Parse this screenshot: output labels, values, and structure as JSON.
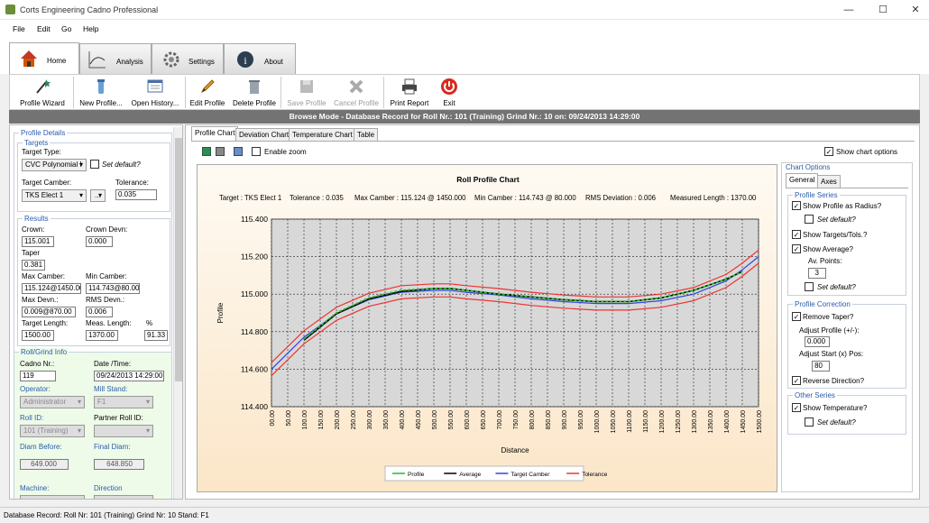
{
  "window": {
    "title": "Corts Engineering Cadno Professional"
  },
  "menu": [
    "File",
    "Edit",
    "Go",
    "Help"
  ],
  "main_tabs": [
    "Home",
    "Analysis",
    "Settings",
    "About"
  ],
  "toolbar": {
    "profile_wizard": "Profile Wizard",
    "new_profile": "New Profile...",
    "open_history": "Open History...",
    "edit_profile": "Edit Profile",
    "delete_profile": "Delete Profile",
    "save_profile": "Save Profile",
    "cancel_profile": "Cancel Profile",
    "print_report": "Print Report",
    "exit": "Exit"
  },
  "mode_banner": "Browse Mode - Database Record for Roll Nr.: 101 (Training) Grind Nr.: 10 on: 09/24/2013 14:29:00",
  "left": {
    "profile_details": "Profile Details",
    "targets": {
      "title": "Targets",
      "target_type_label": "Target Type:",
      "target_type": "CVC Polynomial I",
      "set_default": "Set default?",
      "target_camber_label": "Target Camber:",
      "target_camber": "TKS Elect 1",
      "browse": "...",
      "tolerance_label": "Tolerance:",
      "tolerance": "0.035"
    },
    "results": {
      "title": "Results",
      "crown_label": "Crown:",
      "crown": "115.001",
      "crown_devn_label": "Crown Devn:",
      "crown_devn": "0.000",
      "taper_label": "Taper",
      "taper": "0.381",
      "max_camber_label": "Max Camber:",
      "max_camber": "115.124@1450.00",
      "min_camber_label": "Min Camber:",
      "min_camber": "114.743@80.00",
      "max_devn_label": "Max Devn.:",
      "max_devn": "0.009@870.00",
      "rms_devn_label": "RMS  Devn.:",
      "rms_devn": "0.006",
      "target_length_label": "Target Length:",
      "target_length": "1500.00",
      "meas_length_label": "Meas. Length:",
      "meas_length": "1370.00",
      "pct_label": "%",
      "pct": "91.33"
    },
    "roll_grind": {
      "title": "Roll/Grind Info",
      "cadno_nr_label": "Cadno Nr.:",
      "cadno_nr": "119",
      "datetime_label": "Date /Time:",
      "datetime": "09/24/2013 14:29:00",
      "operator_label": "Operator:",
      "operator": "Administrator",
      "mill_stand_label": "Mill Stand:",
      "mill_stand": "F1",
      "roll_id_label": "Roll ID:",
      "roll_id": "101 (Training)",
      "partner_label": "Partner Roll ID:",
      "partner": "",
      "diam_before_label": "Diam Before:",
      "diam_before": "649.000",
      "final_diam_label": "Final Diam:",
      "final_diam": "648.850",
      "machine_label": "Machine:",
      "direction_label": "Direction"
    }
  },
  "chart_tabs": [
    "Profile Chart",
    "Deviation Chart",
    "Temperature Chart",
    "Table"
  ],
  "enable_zoom": "Enable zoom",
  "show_chart_options": "Show chart options",
  "chart_info": {
    "target": "Target : TKS Elect 1",
    "tolerance": "Tolerance : 0.035",
    "max_camber": "Max Camber : 115.124 @ 1450.000",
    "min_camber": "Min Camber : 114.743 @ 80.000",
    "rms": "RMS Deviation : 0.006",
    "measured": "Measured Length : 1370.00"
  },
  "chart_data": {
    "type": "line",
    "title": "Roll Profile Chart",
    "xlabel": "Distance",
    "ylabel": "Profile",
    "xlim": [
      0,
      1500
    ],
    "ylim": [
      114.4,
      115.4
    ],
    "xticks": [
      "00.00",
      "50.00",
      "100.00",
      "150.00",
      "200.00",
      "250.00",
      "300.00",
      "350.00",
      "400.00",
      "450.00",
      "500.00",
      "550.00",
      "600.00",
      "650.00",
      "700.00",
      "750.00",
      "800.00",
      "850.00",
      "900.00",
      "950.00",
      "1000.00",
      "1050.00",
      "1100.00",
      "1150.00",
      "1200.00",
      "1250.00",
      "1300.00",
      "1350.00",
      "1400.00",
      "1450.00",
      "1500.00"
    ],
    "yticks": [
      "115.400",
      "115.200",
      "115.000",
      "114.800",
      "114.600",
      "114.400"
    ],
    "grid": true,
    "legend_position": "bottom",
    "x": [
      0,
      100,
      200,
      300,
      400,
      500,
      550,
      600,
      700,
      800,
      900,
      1000,
      1100,
      1200,
      1300,
      1400,
      1450,
      1500
    ],
    "series": [
      {
        "name": "Profile",
        "color": "#22bb22",
        "dash": true,
        "values": [
          null,
          114.76,
          114.9,
          114.98,
          115.02,
          115.03,
          115.03,
          115.02,
          115.0,
          114.985,
          114.97,
          114.96,
          114.96,
          114.98,
          115.02,
          115.08,
          115.12,
          null
        ]
      },
      {
        "name": "Average",
        "color": "#000000",
        "values": [
          null,
          114.755,
          114.895,
          114.975,
          115.015,
          115.03,
          115.03,
          115.02,
          115.0,
          114.985,
          114.97,
          114.96,
          114.96,
          114.98,
          115.02,
          115.08,
          115.12,
          null
        ]
      },
      {
        "name": "Target Camber",
        "color": "#3344dd",
        "values": [
          114.6,
          114.77,
          114.895,
          114.97,
          115.01,
          115.02,
          115.02,
          115.01,
          114.995,
          114.975,
          114.96,
          114.95,
          114.95,
          114.965,
          115.0,
          115.07,
          115.13,
          115.2
        ]
      },
      {
        "name": "Tolerance",
        "color": "#ee3333",
        "values": [
          114.635,
          114.805,
          114.93,
          115.005,
          115.045,
          115.055,
          115.055,
          115.045,
          115.03,
          115.01,
          114.995,
          114.985,
          114.985,
          115.0,
          115.035,
          115.105,
          115.165,
          115.235
        ]
      },
      {
        "name": "",
        "color": "#ee3333",
        "values": [
          114.565,
          114.735,
          114.86,
          114.935,
          114.975,
          114.985,
          114.985,
          114.975,
          114.96,
          114.94,
          114.925,
          114.915,
          114.915,
          114.93,
          114.965,
          115.035,
          115.095,
          115.165
        ]
      }
    ]
  },
  "options": {
    "title": "Chart Options",
    "tabs": [
      "General",
      "Axes"
    ],
    "profile_series": "Profile Series",
    "show_radius": "Show Profile as Radius?",
    "set_default": "Set default?",
    "show_targets": "Show Targets/Tols.?",
    "show_average": "Show Average?",
    "av_points_label": "Av. Points:",
    "av_points": "3",
    "profile_correction": "Profile Correction",
    "remove_taper": "Remove Taper?",
    "adjust_profile_label": "Adjust Profile (+/-):",
    "adjust_profile": "0.000",
    "adjust_start_label": "Adjust Start (x) Pos:",
    "adjust_start": "80",
    "reverse_direction": "Reverse Direction?",
    "other_series": "Other Series",
    "show_temperature": "Show Temperature?"
  },
  "status": "Database Record: Roll Nr: 101 (Training) Grind Nr: 10  Stand: F1"
}
